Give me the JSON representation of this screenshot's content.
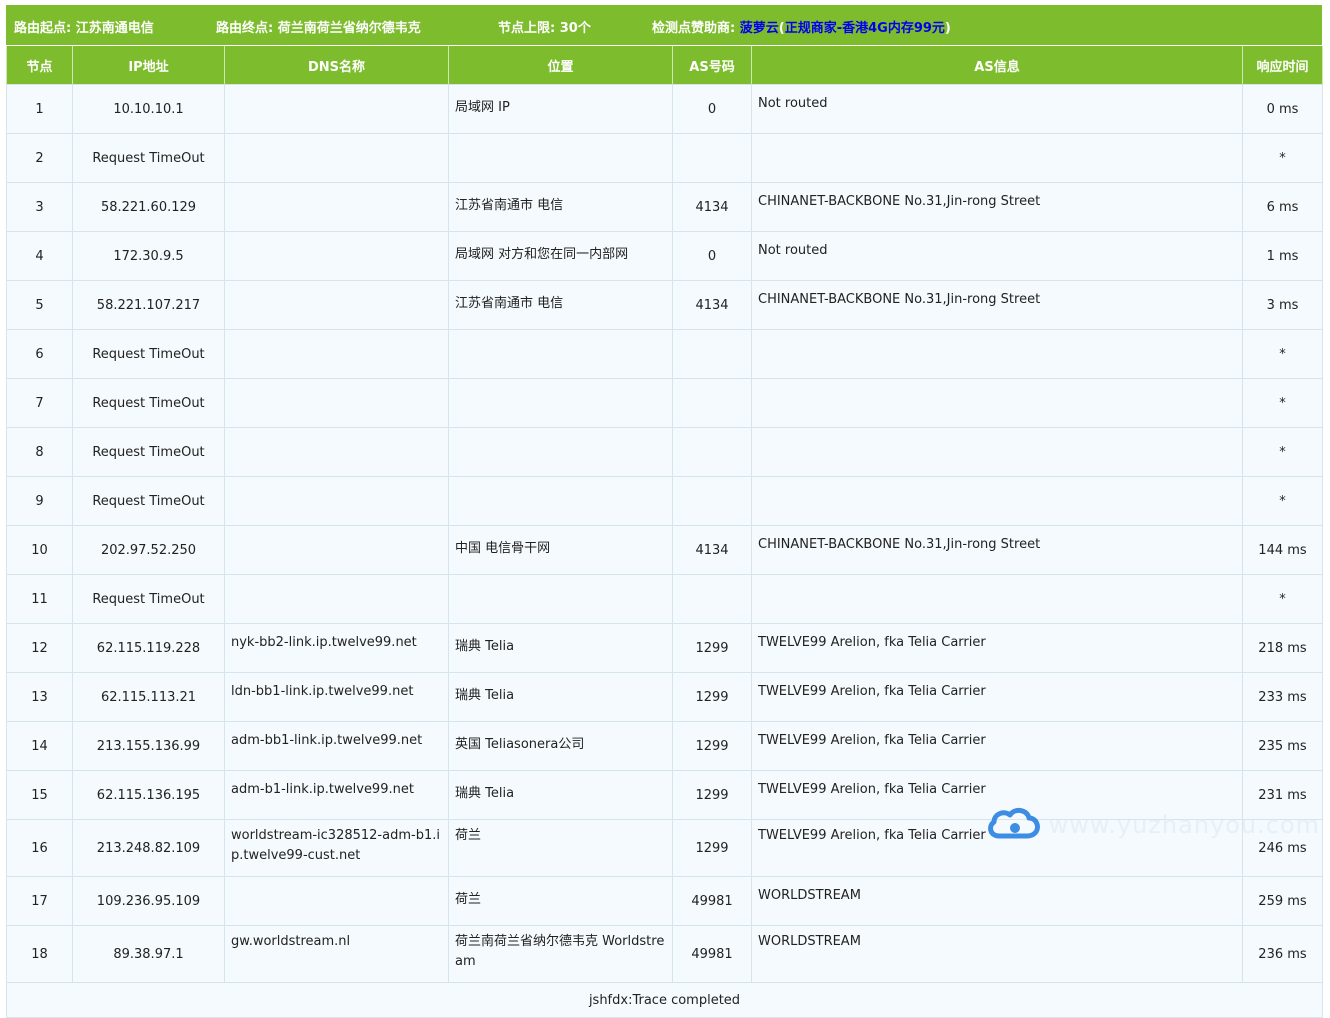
{
  "top_bar": {
    "start_label": "路由起点:",
    "start_value": "江苏南通电信",
    "end_label": "路由终点:",
    "end_value": "荷兰南荷兰省纳尔德韦克",
    "limit_label": "节点上限:",
    "limit_value": "30个",
    "sponsor_label": "检测点赞助商:",
    "sponsor_name": "菠萝云",
    "sponsor_paren_open": "(",
    "sponsor_desc": "正规商家-香港4G内存99元",
    "sponsor_paren_close": ")"
  },
  "columns": [
    "节点",
    "IP地址",
    "DNS名称",
    "位置",
    "AS号码",
    "AS信息",
    "响应时间"
  ],
  "rows": [
    {
      "hop": "1",
      "ip": "10.10.10.1",
      "dns": "",
      "loc": "局域网 IP",
      "asn": "0",
      "asinfo": "Not routed",
      "time": "0 ms"
    },
    {
      "hop": "2",
      "ip": "Request TimeOut",
      "dns": "",
      "loc": "",
      "asn": "",
      "asinfo": "",
      "time": "*"
    },
    {
      "hop": "3",
      "ip": "58.221.60.129",
      "dns": "",
      "loc": "江苏省南通市 电信",
      "asn": "4134",
      "asinfo": "CHINANET-BACKBONE No.31,Jin-rong Street",
      "time": "6 ms"
    },
    {
      "hop": "4",
      "ip": "172.30.9.5",
      "dns": "",
      "loc": "局域网 对方和您在同一内部网",
      "asn": "0",
      "asinfo": "Not routed",
      "time": "1 ms"
    },
    {
      "hop": "5",
      "ip": "58.221.107.217",
      "dns": "",
      "loc": "江苏省南通市 电信",
      "asn": "4134",
      "asinfo": "CHINANET-BACKBONE No.31,Jin-rong Street",
      "time": "3 ms"
    },
    {
      "hop": "6",
      "ip": "Request TimeOut",
      "dns": "",
      "loc": "",
      "asn": "",
      "asinfo": "",
      "time": "*"
    },
    {
      "hop": "7",
      "ip": "Request TimeOut",
      "dns": "",
      "loc": "",
      "asn": "",
      "asinfo": "",
      "time": "*"
    },
    {
      "hop": "8",
      "ip": "Request TimeOut",
      "dns": "",
      "loc": "",
      "asn": "",
      "asinfo": "",
      "time": "*"
    },
    {
      "hop": "9",
      "ip": "Request TimeOut",
      "dns": "",
      "loc": "",
      "asn": "",
      "asinfo": "",
      "time": "*"
    },
    {
      "hop": "10",
      "ip": "202.97.52.250",
      "dns": "",
      "loc": "中国 电信骨干网",
      "asn": "4134",
      "asinfo": "CHINANET-BACKBONE No.31,Jin-rong Street",
      "time": "144 ms"
    },
    {
      "hop": "11",
      "ip": "Request TimeOut",
      "dns": "",
      "loc": "",
      "asn": "",
      "asinfo": "",
      "time": "*"
    },
    {
      "hop": "12",
      "ip": "62.115.119.228",
      "dns": "nyk-bb2-link.ip.twelve99.net",
      "loc": "瑞典 Telia",
      "asn": "1299",
      "asinfo": "TWELVE99 Arelion, fka Telia Carrier",
      "time": "218 ms"
    },
    {
      "hop": "13",
      "ip": "62.115.113.21",
      "dns": "ldn-bb1-link.ip.twelve99.net",
      "loc": "瑞典 Telia",
      "asn": "1299",
      "asinfo": "TWELVE99 Arelion, fka Telia Carrier",
      "time": "233 ms"
    },
    {
      "hop": "14",
      "ip": "213.155.136.99",
      "dns": "adm-bb1-link.ip.twelve99.net",
      "loc": "英国 Teliasonera公司",
      "asn": "1299",
      "asinfo": "TWELVE99 Arelion, fka Telia Carrier",
      "time": "235 ms"
    },
    {
      "hop": "15",
      "ip": "62.115.136.195",
      "dns": "adm-b1-link.ip.twelve99.net",
      "loc": "瑞典 Telia",
      "asn": "1299",
      "asinfo": "TWELVE99 Arelion, fka Telia Carrier",
      "time": "231 ms"
    },
    {
      "hop": "16",
      "ip": "213.248.82.109",
      "dns": "worldstream-ic328512-adm-b1.ip.twelve99-cust.net",
      "loc": "荷兰",
      "asn": "1299",
      "asinfo": "TWELVE99 Arelion, fka Telia Carrier",
      "time": "246 ms",
      "tall": true
    },
    {
      "hop": "17",
      "ip": "109.236.95.109",
      "dns": "",
      "loc": "荷兰",
      "asn": "49981",
      "asinfo": "WORLDSTREAM",
      "time": "259 ms"
    },
    {
      "hop": "18",
      "ip": "89.38.97.1",
      "dns": "gw.worldstream.nl",
      "loc": "荷兰南荷兰省纳尔德韦克 Worldstream",
      "asn": "49981",
      "asinfo": "WORLDSTREAM",
      "time": "236 ms",
      "tall": true
    }
  ],
  "footer": {
    "status": "jshfdx:Trace completed"
  },
  "watermark": {
    "text": "www.yuzhanyou.com",
    "icon": "cloud-logo-icon",
    "color": "#1e7be0"
  }
}
